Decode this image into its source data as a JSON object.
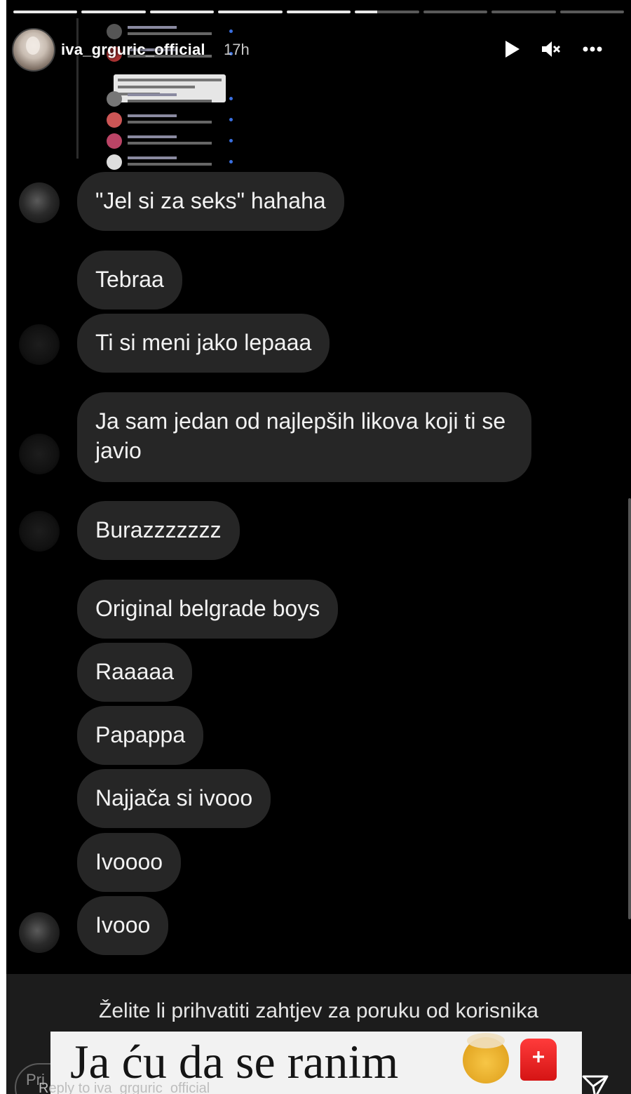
{
  "header": {
    "username": "iva_grguric_official",
    "time_ago": "17h"
  },
  "icons": {
    "play": "play-icon",
    "mute": "mute-icon",
    "more": "more-icon",
    "send": "send-icon"
  },
  "progress": {
    "segments_total": 9,
    "segments_complete": 5,
    "current_segment_fraction": 0.35
  },
  "messages": [
    "\"Jel si za seks\" hahaha",
    "Tebraa",
    "Ti si meni jako lepaaa",
    "Ja sam jedan od najlepših likova koji ti se javio",
    "Burazzzzzzz",
    "Original belgrade boys",
    "Raaaaa",
    "Papappa",
    "Najjača si ivooo",
    "Ivoooo",
    "Ivooo"
  ],
  "footer": {
    "request_text": "Želite li prihvatiti zahtjev za poruku od korisnika",
    "sticker_text": "Ja ću da se ranim",
    "reply_prefix": "Pri",
    "reply_placeholder": "Reply to iva_grguric_official"
  },
  "colors": {
    "background": "#000000",
    "bubble": "#262626",
    "text": "#f2f2f2"
  }
}
